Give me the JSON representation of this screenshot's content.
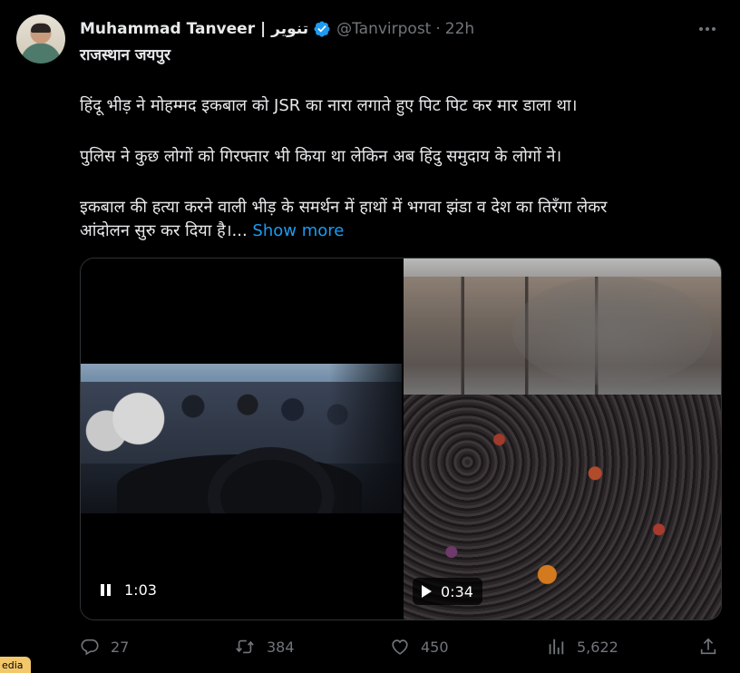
{
  "tweet": {
    "author_name": "Muhammad Tanveer | تنویر",
    "handle": "@Tanvirpost",
    "separator": "·",
    "time": "22h",
    "verified": true,
    "location_line": "राजस्थान जयपुर",
    "lines": [
      "हिंदू भीड़ ने मोहम्मद इकबाल को JSR का नारा लगाते हुए पिट पिट कर मार डाला था।",
      "पुलिस ने कुछ लोगों को गिरफ्तार भी किया था लेकिन अब हिंदु समुदाय के लोगों ने।",
      "इकबाल की हत्या करने वाली भीड़ के समर्थन में हाथों में भगवा झंडा व देश का तिरँगा लेकर",
      "आंदोलन सुरु कर दिया है।..."
    ],
    "show_more_label": "Show more"
  },
  "media": {
    "video1": {
      "duration": "1:03",
      "state": "pause-icon"
    },
    "video2": {
      "duration": "0:34",
      "state": "play-icon"
    }
  },
  "actions": {
    "replies": "27",
    "retweets": "384",
    "likes": "450",
    "views": "5,622"
  },
  "corner_tab_label": "edia",
  "colors": {
    "background": "#000000",
    "text": "#e7e9ea",
    "muted": "#71767b",
    "link": "#1d9bf0",
    "verified": "#1d9bf0"
  }
}
